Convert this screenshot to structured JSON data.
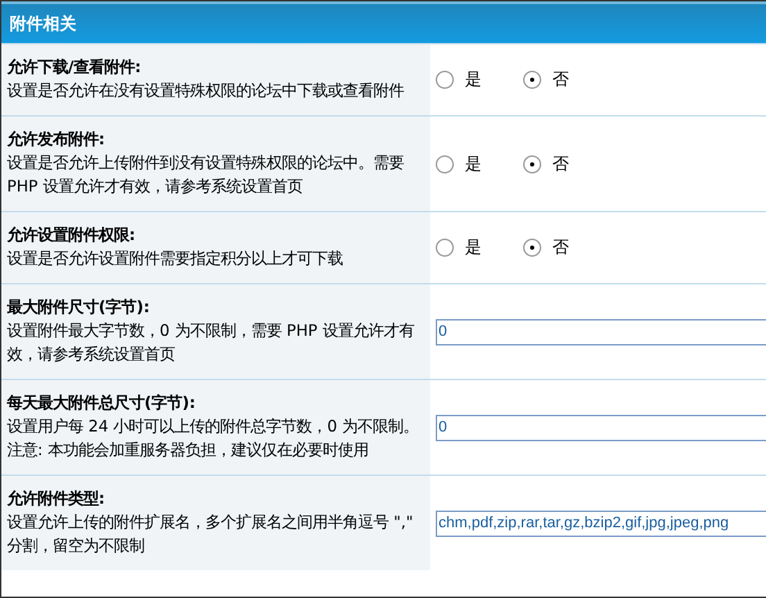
{
  "panel": {
    "title": "附件相关"
  },
  "settings": [
    {
      "kind": "radio",
      "label": "允许下载/查看附件:",
      "description": "设置是否允许在没有设置特殊权限的论坛中下载或查看附件",
      "options": [
        {
          "label": "是",
          "selected": false
        },
        {
          "label": "否",
          "selected": true
        }
      ]
    },
    {
      "kind": "radio",
      "label": "允许发布附件:",
      "description": "设置是否允许上传附件到没有设置特殊权限的论坛中。需要 PHP 设置允许才有效，请参考系统设置首页",
      "options": [
        {
          "label": "是",
          "selected": false
        },
        {
          "label": "否",
          "selected": true
        }
      ]
    },
    {
      "kind": "radio",
      "label": "允许设置附件权限:",
      "description": "设置是否允许设置附件需要指定积分以上才可下载",
      "options": [
        {
          "label": "是",
          "selected": false
        },
        {
          "label": "否",
          "selected": true
        }
      ]
    },
    {
      "kind": "input",
      "label": "最大附件尺寸(字节):",
      "description": "设置附件最大字节数，0 为不限制，需要 PHP 设置允许才有效，请参考系统设置首页",
      "value": "0"
    },
    {
      "kind": "input",
      "label": "每天最大附件总尺寸(字节):",
      "description": "设置用户每 24 小时可以上传的附件总字节数，0 为不限制。注意: 本功能会加重服务器负担，建议仅在必要时使用",
      "value": "0"
    },
    {
      "kind": "input",
      "label": "允许附件类型:",
      "description": "设置允许上传的附件扩展名，多个扩展名之间用半角逗号 \",\" 分割，留空为不限制",
      "value": "chm,pdf,zip,rar,tar,gz,bzip2,gif,jpg,jpeg,png"
    }
  ]
}
